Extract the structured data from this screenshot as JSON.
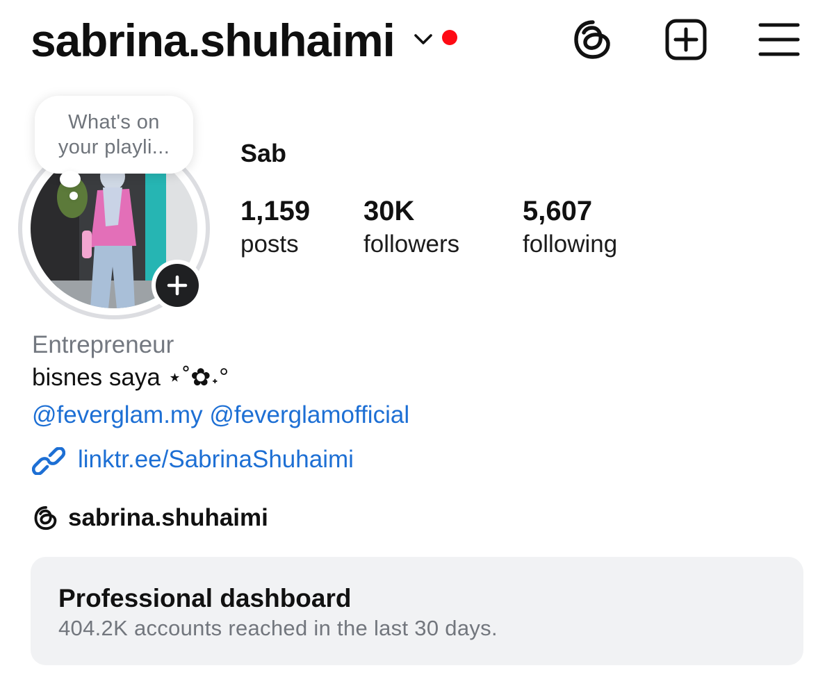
{
  "header": {
    "username": "sabrina.shuhaimi",
    "notification_color": "#fe0a14"
  },
  "icons": {
    "threads": "threads-icon",
    "create": "plus-square-icon",
    "menu": "hamburger-menu-icon",
    "switch": "chevron-down-icon",
    "link": "link-icon",
    "add_story": "plus-icon"
  },
  "note": {
    "text": "What's on\nyour playli..."
  },
  "profile": {
    "display_name": "Sab",
    "stats": [
      {
        "value": "1,159",
        "label": "posts"
      },
      {
        "value": "30K",
        "label": "followers"
      },
      {
        "value": "5,607",
        "label": "following"
      }
    ]
  },
  "bio": {
    "category": "Entrepreneur",
    "text": "bisnes saya ⋆˚✿˖°",
    "mentions": [
      "@feverglam.my",
      "@feverglamofficial"
    ],
    "link": "linktr.ee/SabrinaShuhaimi",
    "threads_handle": "sabrina.shuhaimi"
  },
  "dashboard": {
    "title": "Professional dashboard",
    "subtitle": "404.2K accounts reached in the last 30 days."
  },
  "colors": {
    "link": "#1d6fd4",
    "muted": "#737880",
    "card_bg": "#f1f2f4"
  }
}
